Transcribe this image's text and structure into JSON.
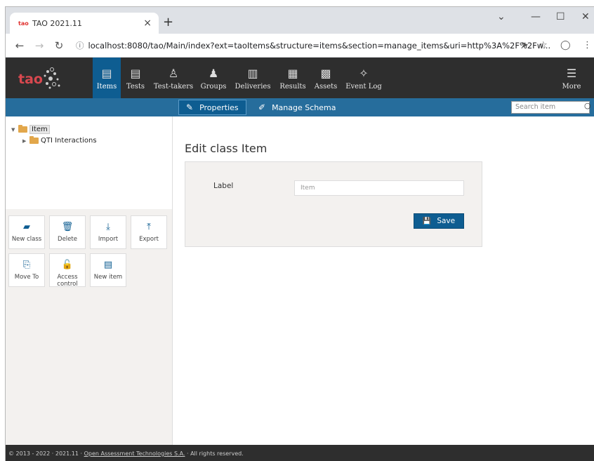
{
  "browser": {
    "tab_favicon": "tao",
    "tab_title": "TAO 2021.11",
    "tab_close": "×",
    "new_tab": "+",
    "url": "localhost:8080/tao/Main/index?ext=taoItems&structure=items&section=manage_items&uri=http%3A%2F%2Fw...",
    "window_controls": [
      "⌄",
      "—",
      "☐",
      "✕"
    ]
  },
  "header": {
    "logo_text": "tao",
    "nav": [
      {
        "label": "Items",
        "icon": "items-icon",
        "active": true
      },
      {
        "label": "Tests",
        "icon": "tests-icon",
        "active": false
      },
      {
        "label": "Test-takers",
        "icon": "test-takers-icon",
        "active": false
      },
      {
        "label": "Groups",
        "icon": "groups-icon",
        "active": false
      },
      {
        "label": "Deliveries",
        "icon": "deliveries-icon",
        "active": false
      },
      {
        "label": "Results",
        "icon": "results-icon",
        "active": false
      },
      {
        "label": "Assets",
        "icon": "assets-icon",
        "active": false
      },
      {
        "label": "Event Log",
        "icon": "event-log-icon",
        "active": false
      }
    ],
    "more_label": "More"
  },
  "actions": {
    "properties_label": "Properties",
    "manage_schema_label": "Manage Schema",
    "search_placeholder": "Search item"
  },
  "tree": {
    "root_label": "Item",
    "child_label": "QTI Interactions"
  },
  "tools": [
    {
      "label": "New class",
      "icon": "new-class-icon"
    },
    {
      "label": "Delete",
      "icon": "trash-icon"
    },
    {
      "label": "Import",
      "icon": "import-icon"
    },
    {
      "label": "Export",
      "icon": "export-icon"
    },
    {
      "label": "Move To",
      "icon": "move-to-icon"
    },
    {
      "label": "Access control",
      "icon": "unlock-icon"
    },
    {
      "label": "New item",
      "icon": "new-item-icon"
    }
  ],
  "main": {
    "title": "Edit class Item",
    "label_field": "Label",
    "label_value": "Item",
    "save_label": "Save"
  },
  "footer": {
    "prefix": "© 2013 - 2022 · 2021.11 · ",
    "company": "Open Assessment Technologies S.A.",
    "suffix": " · All rights reserved."
  },
  "colors": {
    "header_bg": "#2e2e2e",
    "accent": "#0e5d91",
    "action_bar": "#266d9c",
    "folder": "#e2a74b",
    "logo": "#d8484f"
  }
}
